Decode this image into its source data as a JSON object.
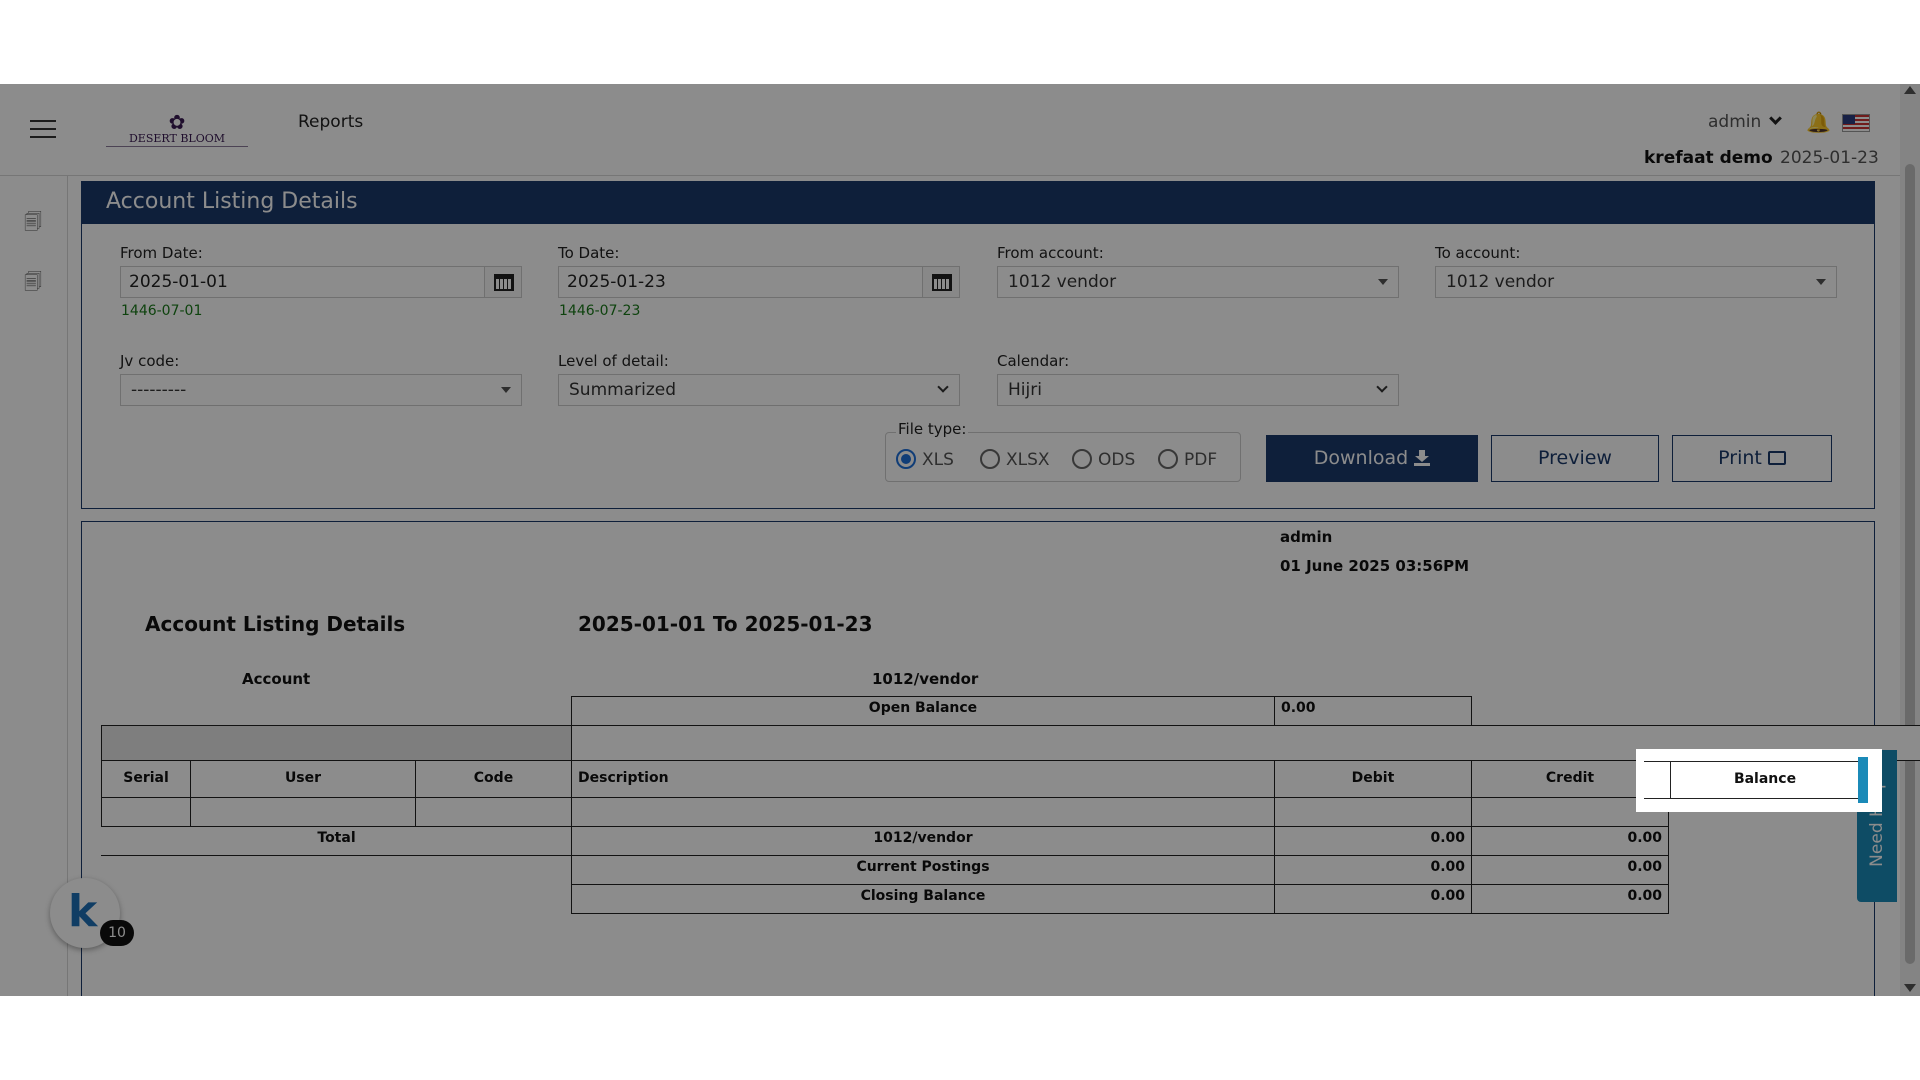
{
  "header": {
    "logo_text": "DESERT BLOOM",
    "breadcrumb": "Reports",
    "user": "admin",
    "company": "krefaat demo",
    "date": "2025-01-23"
  },
  "form": {
    "title": "Account Listing Details",
    "from_date_label": "From Date:",
    "from_date": "2025-01-01",
    "from_date_hijri": "1446-07-01",
    "to_date_label": "To Date:",
    "to_date": "2025-01-23",
    "to_date_hijri": "1446-07-23",
    "from_account_label": "From account:",
    "from_account": "1012 vendor",
    "to_account_label": "To account:",
    "to_account": "1012 vendor",
    "jv_code_label": "Jv code:",
    "jv_code": "---------",
    "level_label": "Level of detail:",
    "level": "Summarized",
    "calendar_label": "Calendar:",
    "calendar": "Hijri",
    "file_type_label": "File type:",
    "file_types": [
      "XLS",
      "XLSX",
      "ODS",
      "PDF"
    ],
    "file_type_selected": "XLS",
    "download_label": "Download",
    "preview_label": "Preview",
    "print_label": "Print"
  },
  "report": {
    "user": "admin",
    "generated": "01 June 2025 03:56PM",
    "title": "Account Listing Details",
    "range": "2025-01-01 To 2025-01-23",
    "account_label": "Account",
    "account_value": "1012/vendor",
    "open_balance_label": "Open Balance",
    "open_balance": "0.00",
    "columns": [
      "Serial",
      "User",
      "Code",
      "Description",
      "Debit",
      "Credit",
      "Balance"
    ],
    "total_label": "Total",
    "total_rows": [
      {
        "label": "1012/vendor",
        "debit": "0.00",
        "credit": "0.00"
      },
      {
        "label": "Current Postings",
        "debit": "0.00",
        "credit": "0.00"
      },
      {
        "label": "Closing Balance",
        "debit": "0.00",
        "credit": "0.00"
      }
    ]
  },
  "widgets": {
    "badge_count": "10",
    "need_help": "Need Help?"
  }
}
